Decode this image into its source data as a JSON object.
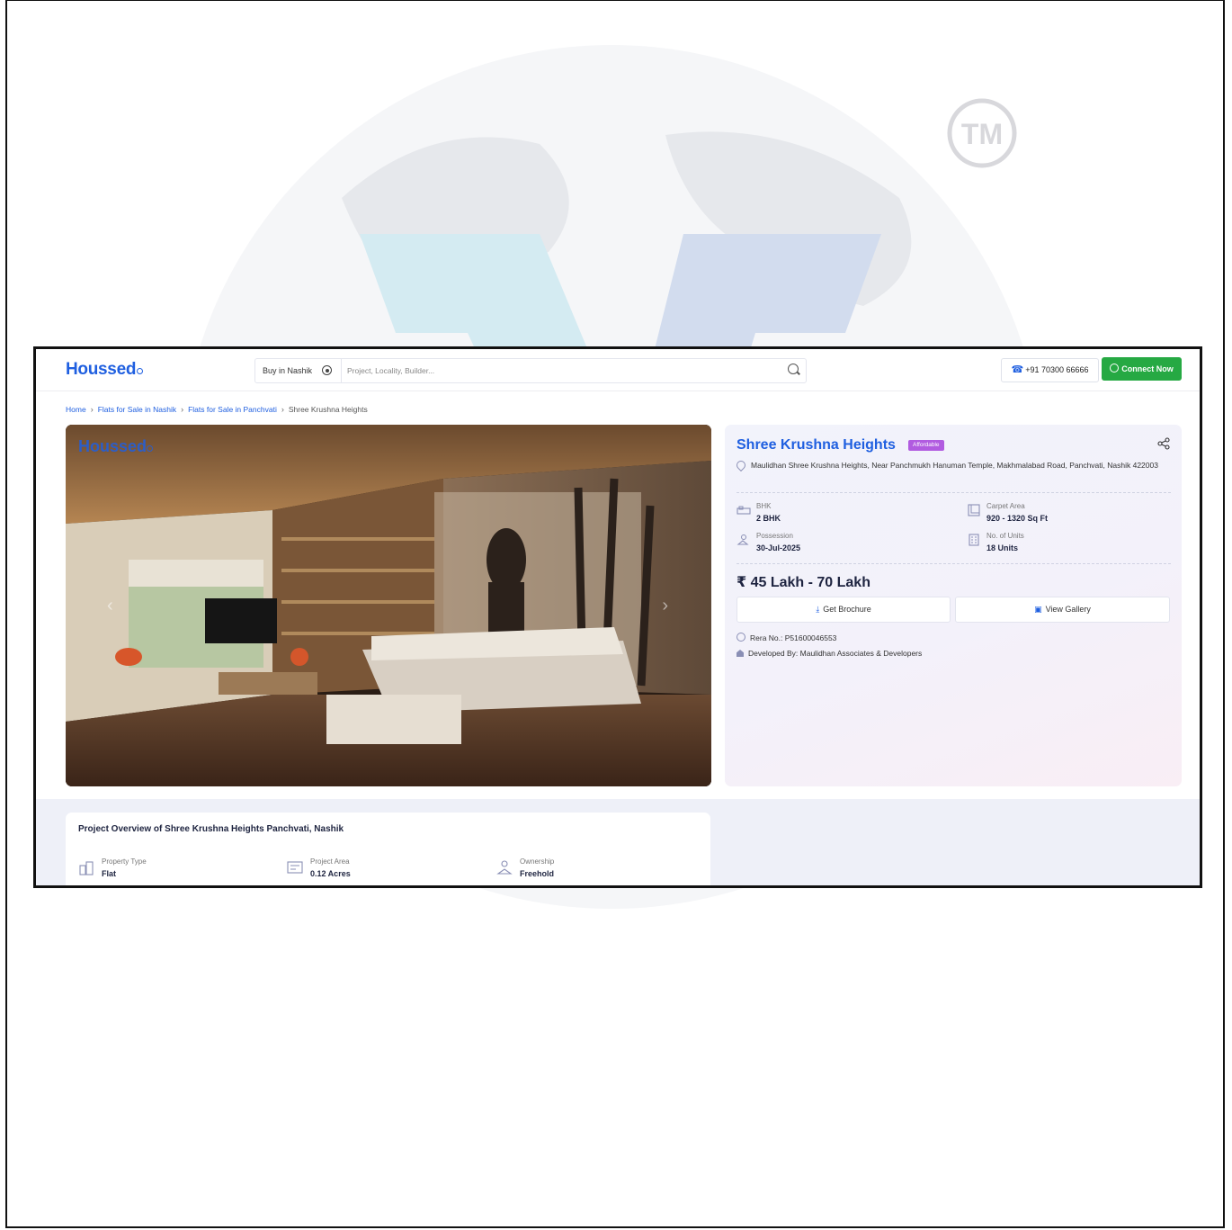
{
  "header": {
    "logo_text": "Houssed",
    "city_selector": "Buy in Nashik",
    "search_placeholder": "Project, Locality, Builder...",
    "phone": "+91 70300 66666",
    "connect_label": "Connect Now"
  },
  "breadcrumb": {
    "items": [
      "Home",
      "Flats for Sale in Nashik",
      "Flats for Sale in Panchvati"
    ],
    "current": "Shree Krushna Heights"
  },
  "hero": {
    "watermark_logo": "Houssed"
  },
  "project": {
    "name": "Shree Krushna Heights",
    "tag": "Affordable",
    "address": "Maulidhan Shree Krushna Heights, Near Panchmukh Hanuman Temple, Makhmalabad Road, Panchvati, Nashik 422003",
    "specs": [
      {
        "label": "BHK",
        "value": "2 BHK",
        "icon": "bhk-icon"
      },
      {
        "label": "Carpet Area",
        "value": "920 - 1320 Sq Ft",
        "icon": "carpet-area-icon"
      },
      {
        "label": "Possession",
        "value": "30-Jul-2025",
        "icon": "possession-icon"
      },
      {
        "label": "No. of Units",
        "value": "18 Units",
        "icon": "units-icon"
      }
    ],
    "price": "₹ 45 Lakh - 70 Lakh",
    "brochure_label": "Get Brochure",
    "gallery_label": "View Gallery",
    "rera": "Rera No.: P51600046553",
    "developer": "Developed By: Maulidhan Associates & Developers"
  },
  "overview": {
    "title": "Project Overview of Shree Krushna Heights Panchvati, Nashik",
    "items": [
      {
        "label": "Property Type",
        "value": "Flat",
        "icon": "property-type-icon"
      },
      {
        "label": "Project Area",
        "value": "0.12 Acres",
        "icon": "project-area-icon"
      },
      {
        "label": "Ownership",
        "value": "Freehold",
        "icon": "ownership-icon"
      }
    ]
  },
  "colors": {
    "brand_blue": "#1f5fe0",
    "whatsapp_green": "#26a943",
    "tag_purple": "#b15be0",
    "text_dark": "#1e2440"
  }
}
